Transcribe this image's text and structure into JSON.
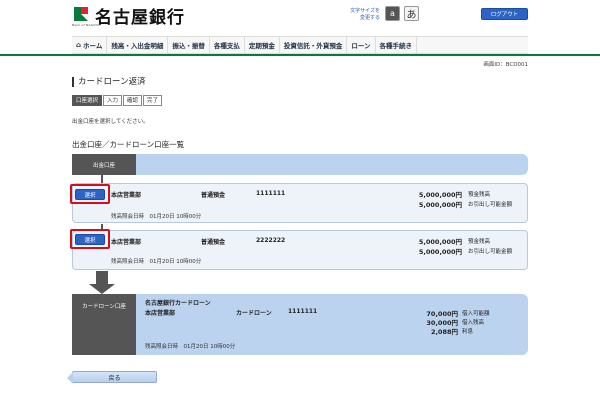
{
  "header": {
    "bank_name": "名古屋銀行",
    "logo_sub": "Bank of NAGOYA",
    "font_size_label_line1": "文字サイズを",
    "font_size_label_line2": "変更する",
    "font_small": "a",
    "font_large": "あ",
    "logout_label": "ログアウト",
    "brand_color": "#0a7a3a",
    "accent_color": "#2b63c7"
  },
  "nav": {
    "items": [
      {
        "label": "ホーム",
        "icon": "home-icon"
      },
      {
        "label": "残高・入出金明細"
      },
      {
        "label": "振込・振替"
      },
      {
        "label": "各種支払"
      },
      {
        "label": "定期預金"
      },
      {
        "label": "投資信託・外貨預金"
      },
      {
        "label": "ローン"
      },
      {
        "label": "各種手続き"
      }
    ]
  },
  "screen_id": "画面ID：BCD001",
  "page_title": "カードローン返済",
  "steps": [
    "口座選択",
    "入力",
    "確認",
    "完了"
  ],
  "active_step": 0,
  "instruction": "出金口座を選択してください。",
  "section_title": "出金口座／カードローン口座一覧",
  "source_header": "出金口座",
  "accounts": [
    {
      "select_label": "選択",
      "branch": "本店営業部",
      "type": "普通預金",
      "number": "1111111",
      "balance": "5,000,000円",
      "balance_label": "預金残高",
      "available": "5,000,000円",
      "available_label": "お引出し可能金額",
      "inquiry": "残高照会日時　01月20日 10時00分"
    },
    {
      "select_label": "選択",
      "branch": "本店営業部",
      "type": "普通預金",
      "number": "2222222",
      "balance": "5,000,000円",
      "balance_label": "預金残高",
      "available": "5,000,000円",
      "available_label": "お引出し可能金額",
      "inquiry": "残高照会日時　01月20日 10時00分"
    }
  ],
  "loan": {
    "header": "カードローン口座",
    "name": "名古屋銀行カードローン",
    "branch": "本店営業部",
    "type": "カードローン",
    "number": "1111111",
    "limit": "70,000円",
    "limit_label": "借入可能額",
    "balance": "30,000円",
    "balance_label": "借入残高",
    "interest": "2,088円",
    "interest_label": "利息",
    "inquiry": "残高照会日時　01月20日 10時00分"
  },
  "back_label": "戻る"
}
